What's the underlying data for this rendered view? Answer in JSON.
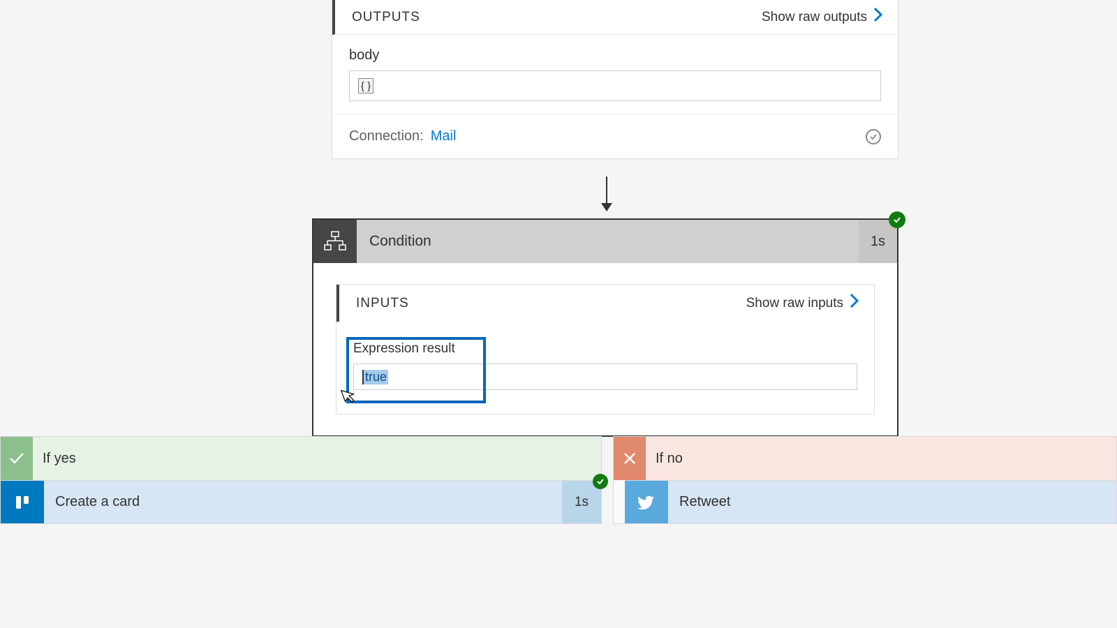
{
  "top": {
    "outputs_label": "OUTPUTS",
    "show_raw_outputs": "Show raw outputs",
    "body_label": "body",
    "body_value": "{ }",
    "connection_label": "Connection:",
    "connection_link": "Mail"
  },
  "condition": {
    "title": "Condition",
    "duration": "1s",
    "inputs_label": "INPUTS",
    "show_raw_inputs": "Show raw inputs",
    "expression_label": "Expression result",
    "expression_value": "true"
  },
  "branches": {
    "yes": {
      "title": "If yes",
      "action": {
        "title": "Create a card",
        "duration": "1s"
      }
    },
    "no": {
      "title": "If no",
      "action": {
        "title": "Retweet"
      }
    }
  }
}
